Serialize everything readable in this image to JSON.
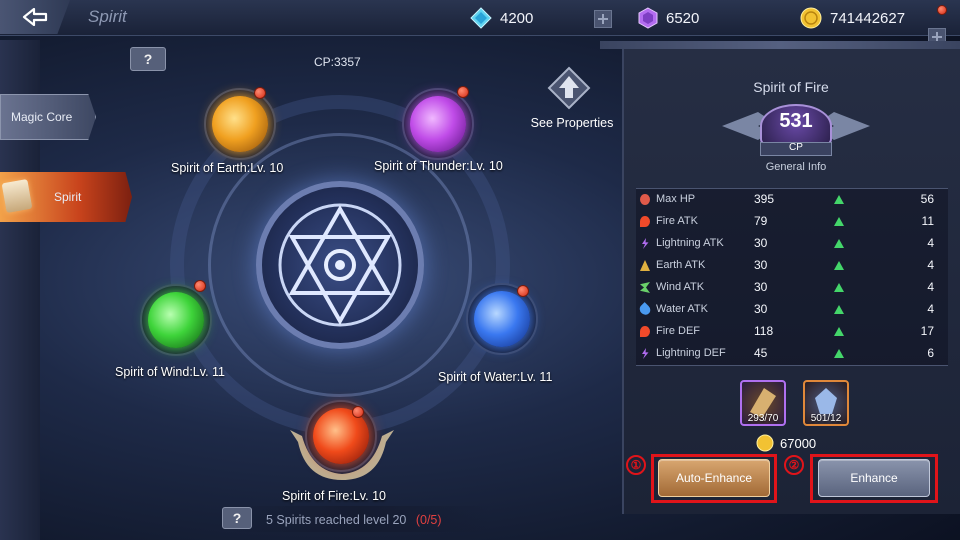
{
  "header": {
    "title": "Spirit",
    "currencies": [
      {
        "icon": "diamond-icon",
        "value": "4200",
        "color": "#5fd3f0"
      },
      {
        "icon": "purple-crystal-icon",
        "value": "6520",
        "color": "#b36cf0"
      },
      {
        "icon": "gold-coin-icon",
        "value": "741442627",
        "color": "#f2c232"
      }
    ]
  },
  "sidebar": {
    "items": [
      {
        "label": "Magic Core",
        "active": false
      },
      {
        "label": "Spirit",
        "active": true
      }
    ]
  },
  "main": {
    "cp_label": "CP:3357",
    "help_glyph": "?",
    "see_properties": "See Properties",
    "spirits": [
      {
        "name": "Spirit of Earth:Lv. 10",
        "color": "#f0a020"
      },
      {
        "name": "Spirit of Thunder:Lv. 10",
        "color": "#c04ce8"
      },
      {
        "name": "Spirit of Wind:Lv. 11",
        "color": "#3ed43a"
      },
      {
        "name": "Spirit of Water:Lv. 11",
        "color": "#3a78f0"
      },
      {
        "name": "Spirit of Fire:Lv. 10",
        "color": "#f04a1a"
      }
    ],
    "achievement": {
      "text": "5 Spirits reached level 20",
      "progress": "(0/5)"
    }
  },
  "panel": {
    "title": "Spirit of Fire",
    "cp_value": "531",
    "cp_label": "CP",
    "general_info": "General Info",
    "stats": [
      {
        "name": "Max HP",
        "value": "395",
        "increase": "56",
        "icon_color": "#e05a4a"
      },
      {
        "name": "Fire ATK",
        "value": "79",
        "increase": "11",
        "icon_color": "#f04a2a"
      },
      {
        "name": "Lightning ATK",
        "value": "30",
        "increase": "4",
        "icon_color": "#b06cf0"
      },
      {
        "name": "Earth ATK",
        "value": "30",
        "increase": "4",
        "icon_color": "#e0b040"
      },
      {
        "name": "Wind ATK",
        "value": "30",
        "increase": "4",
        "icon_color": "#6ad06a"
      },
      {
        "name": "Water ATK",
        "value": "30",
        "increase": "4",
        "icon_color": "#4a9af0"
      },
      {
        "name": "Fire DEF",
        "value": "118",
        "increase": "17",
        "icon_color": "#f04a2a"
      },
      {
        "name": "Lightning DEF",
        "value": "45",
        "increase": "6",
        "icon_color": "#b06cf0"
      }
    ],
    "materials": [
      {
        "count": "293/70",
        "border": "#b070f0"
      },
      {
        "count": "501/12",
        "border": "#e0883a"
      }
    ],
    "cost": "67000",
    "auto_enhance_label": "Auto-Enhance",
    "enhance_label": "Enhance",
    "marker_1": "①",
    "marker_2": "②"
  }
}
